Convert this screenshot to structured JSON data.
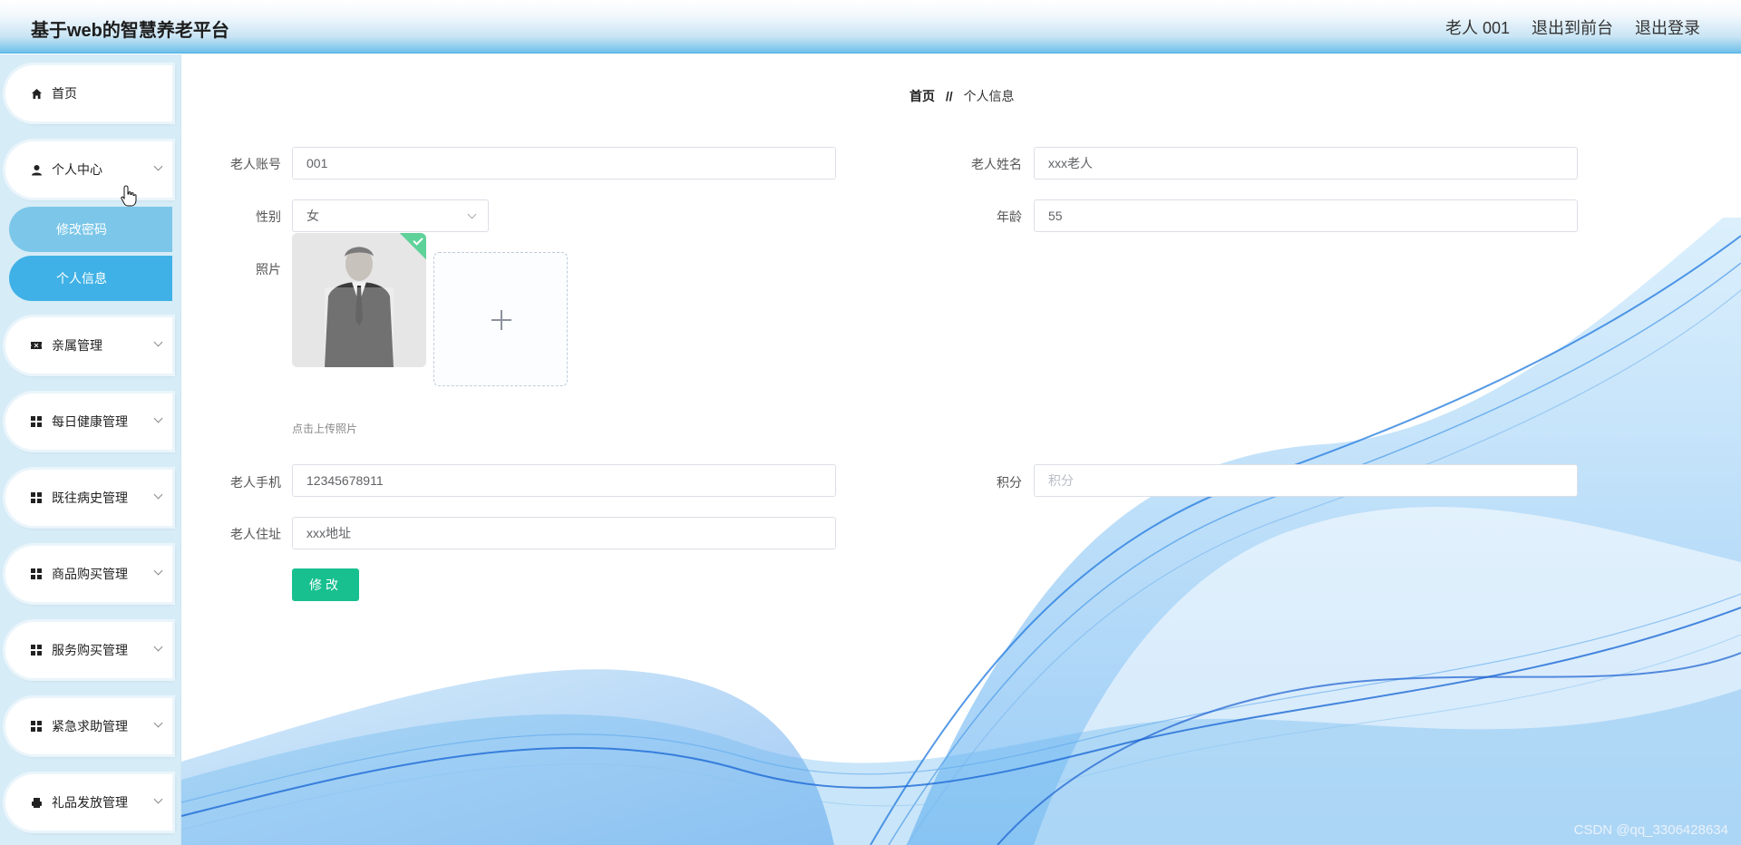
{
  "header": {
    "title": "基于web的智慧养老平台",
    "links": [
      "老人 001",
      "退出到前台",
      "退出登录"
    ]
  },
  "sidebar": {
    "items": [
      {
        "label": "首页",
        "icon": "home-icon"
      },
      {
        "label": "个人中心",
        "icon": "user-icon",
        "expanded": true,
        "children": [
          {
            "label": "修改密码"
          },
          {
            "label": "个人信息",
            "active": true
          }
        ]
      },
      {
        "label": "亲属管理",
        "icon": "ticket-icon"
      },
      {
        "label": "每日健康管理",
        "icon": "grid-icon"
      },
      {
        "label": "既往病史管理",
        "icon": "grid-icon"
      },
      {
        "label": "商品购买管理",
        "icon": "grid-icon"
      },
      {
        "label": "服务购买管理",
        "icon": "grid-icon"
      },
      {
        "label": "紧急求助管理",
        "icon": "grid-icon"
      },
      {
        "label": "礼品发放管理",
        "icon": "printer-icon"
      }
    ]
  },
  "breadcrumb": {
    "home": "首页",
    "separator": "//",
    "current": "个人信息"
  },
  "form": {
    "account": {
      "label": "老人账号",
      "value": "001"
    },
    "name": {
      "label": "老人姓名",
      "value": "xxx老人"
    },
    "gender": {
      "label": "性别",
      "value": "女"
    },
    "age": {
      "label": "年龄",
      "value": "55"
    },
    "photo": {
      "label": "照片",
      "tip": "点击上传照片"
    },
    "phone": {
      "label": "老人手机",
      "value": "12345678911"
    },
    "points": {
      "label": "积分",
      "placeholder": "积分"
    },
    "address": {
      "label": "老人住址",
      "value": "xxx地址"
    },
    "submit_label": "修改"
  },
  "watermark": "CSDN @qq_3306428634",
  "colors": {
    "accent": "#3fb1e6",
    "submit": "#18c08f",
    "sidebar_bg": "#d6ecf7"
  }
}
